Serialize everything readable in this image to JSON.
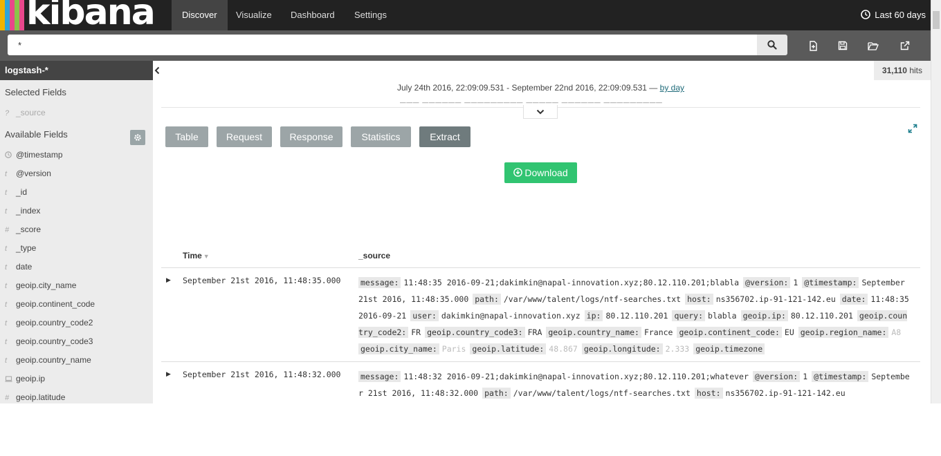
{
  "brand": {
    "name": "kibana",
    "stripe_colors": [
      "#f0b400",
      "#e8478b",
      "#2fa4d8",
      "#8bc34a",
      "#ffffff"
    ]
  },
  "nav": {
    "items": [
      "Discover",
      "Visualize",
      "Dashboard",
      "Settings"
    ],
    "active": "Discover",
    "timepicker_label": "Last 60 days"
  },
  "search": {
    "value": "*"
  },
  "sidebar": {
    "index_pattern": "logstash-*",
    "selected_heading": "Selected Fields",
    "selected_fields": [
      {
        "type": "?",
        "name": "_source"
      }
    ],
    "available_heading": "Available Fields",
    "available_fields": [
      {
        "type": "clock",
        "name": "@timestamp"
      },
      {
        "type": "t",
        "name": "@version"
      },
      {
        "type": "t",
        "name": "_id"
      },
      {
        "type": "t",
        "name": "_index"
      },
      {
        "type": "#",
        "name": "_score"
      },
      {
        "type": "t",
        "name": "_type"
      },
      {
        "type": "t",
        "name": "date"
      },
      {
        "type": "t",
        "name": "geoip.city_name"
      },
      {
        "type": "t",
        "name": "geoip.continent_code"
      },
      {
        "type": "t",
        "name": "geoip.country_code2"
      },
      {
        "type": "t",
        "name": "geoip.country_code3"
      },
      {
        "type": "t",
        "name": "geoip.country_name"
      },
      {
        "type": "ip",
        "name": "geoip.ip"
      },
      {
        "type": "#",
        "name": "geoip.latitude"
      }
    ]
  },
  "main": {
    "hits_count": "31,110",
    "hits_label": "hits",
    "date_range": "July 24th 2016, 22:09:09.531 - September 22nd 2016, 22:09:09.531 —",
    "interval_link": "by day",
    "tabs": [
      "Table",
      "Request",
      "Response",
      "Statistics",
      "Extract"
    ],
    "active_tab": "Extract",
    "download_label": "Download",
    "columns": {
      "time": "Time",
      "source": "_source"
    },
    "rows": [
      {
        "time": "September 21st 2016, 11:48:35.000",
        "fields": [
          {
            "k": "message:",
            "v": "11:48:35 2016-09-21;dakimkin@napal-innovation.xyz;80.12.110.201;blabla"
          },
          {
            "k": "@version:",
            "v": "1"
          },
          {
            "k": "@timestamp:",
            "v": "September 21st 2016, 11:48:35.000"
          },
          {
            "k": "path:",
            "v": "/var/www/talent/logs/ntf-searches.txt"
          },
          {
            "k": "host:",
            "v": "ns356702.ip-91-121-142.eu"
          },
          {
            "k": "date:",
            "v": "11:48:35 2016-09-21"
          },
          {
            "k": "user:",
            "v": "dakimkin@napal-innovation.xyz"
          },
          {
            "k": "ip:",
            "v": "80.12.110.201"
          },
          {
            "k": "query:",
            "v": "blabla"
          },
          {
            "k": "geoip.ip:",
            "v": "80.12.110.201"
          },
          {
            "k": "geoip.country_code2:",
            "v": "FR"
          },
          {
            "k": "geoip.country_code3:",
            "v": "FRA"
          },
          {
            "k": "geoip.country_name:",
            "v": "France"
          },
          {
            "k": "geoip.continent_code:",
            "v": "EU"
          },
          {
            "k": "geoip.region_name:",
            "v": "A8"
          },
          {
            "k": "geoip.city_name:",
            "v": "Paris"
          },
          {
            "k": "geoip.latitude:",
            "v": "48.867"
          },
          {
            "k": "geoip.longitude:",
            "v": "2.333"
          },
          {
            "k": "geoip.timezone",
            "v": ""
          }
        ]
      },
      {
        "time": "September 21st 2016, 11:48:32.000",
        "fields": [
          {
            "k": "message:",
            "v": "11:48:32 2016-09-21;dakimkin@napal-innovation.xyz;80.12.110.201;whatever"
          },
          {
            "k": "@version:",
            "v": "1"
          },
          {
            "k": "@timestamp:",
            "v": "September 21st 2016, 11:48:32.000"
          },
          {
            "k": "path:",
            "v": "/var/www/talent/logs/ntf-searches.txt"
          },
          {
            "k": "host:",
            "v": "ns356702.ip-91-121-142.eu"
          }
        ]
      }
    ]
  }
}
